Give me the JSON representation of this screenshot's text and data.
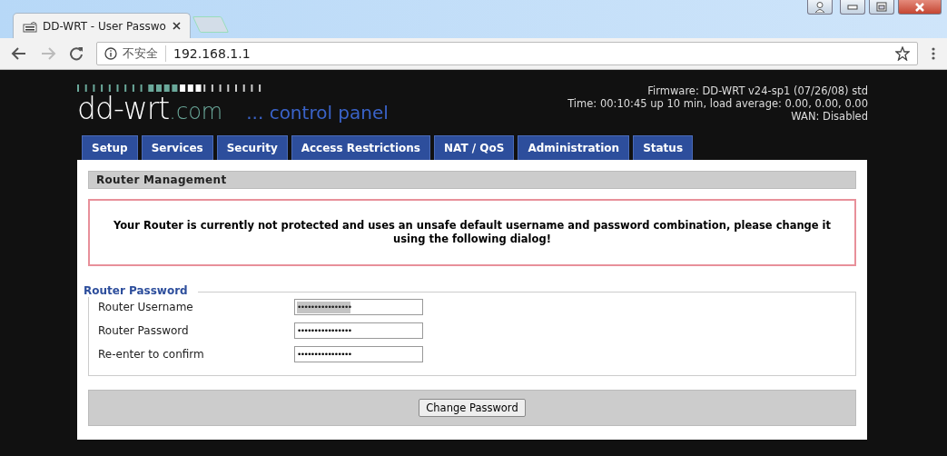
{
  "browser": {
    "tab_title": "DD-WRT - User Passwo",
    "security_label": "不安全",
    "url": "192.168.1.1"
  },
  "header": {
    "logo_main": "dd-wrt",
    "logo_suffix": ".com",
    "tagline": "... control panel",
    "info": [
      "Firmware: DD-WRT v24-sp1 (07/26/08) std",
      "Time: 00:10:45 up 10 min, load average: 0.00, 0.00, 0.00",
      "WAN: Disabled"
    ]
  },
  "tabs": [
    {
      "label": "Setup",
      "selected": false
    },
    {
      "label": "Services",
      "selected": false
    },
    {
      "label": "Security",
      "selected": false
    },
    {
      "label": "Access Restrictions",
      "selected": false
    },
    {
      "label": "NAT / QoS",
      "selected": false
    },
    {
      "label": "Administration",
      "selected": false
    },
    {
      "label": "Status",
      "selected": false
    }
  ],
  "section_title": "Router Management",
  "warning": "Your Router is currently not protected and uses an unsafe default username and password combination, please change it using the following dialog!",
  "fieldset": {
    "legend": "Router Password",
    "fields": [
      {
        "label": "Router Username",
        "value": "••••••••••••••••",
        "text_selected": true
      },
      {
        "label": "Router Password",
        "value": "••••••••••••••••",
        "text_selected": false
      },
      {
        "label": "Re-enter to confirm",
        "value": "••••••••••••••••",
        "text_selected": false
      }
    ]
  },
  "submit_button": "Change Password"
}
